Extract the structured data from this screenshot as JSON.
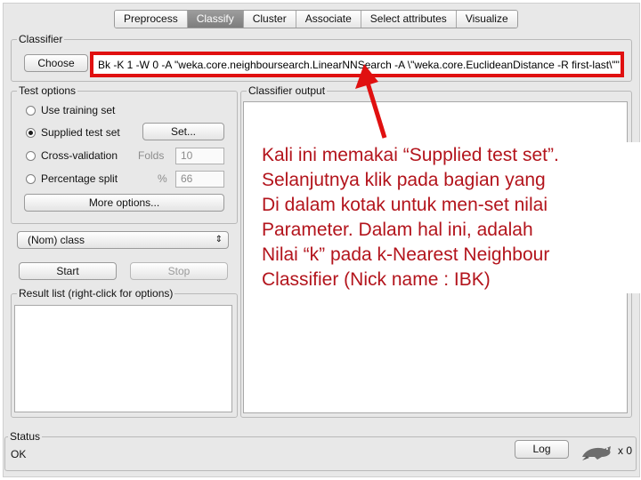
{
  "tabs": [
    "Preprocess",
    "Classify",
    "Cluster",
    "Associate",
    "Select attributes",
    "Visualize"
  ],
  "classifier": {
    "label": "Classifier",
    "choose_label": "Choose",
    "config_text": "Bk -K 1 -W 0 -A \"weka.core.neighboursearch.LinearNNSearch -A \\\"weka.core.EuclideanDistance -R first-last\\\"\""
  },
  "test_options": {
    "label": "Test options",
    "use_training": "Use training set",
    "supplied": "Supplied test set",
    "set_label": "Set...",
    "cross_validation": "Cross-validation",
    "folds_label": "Folds",
    "folds_value": "10",
    "percentage_split": "Percentage split",
    "percent_symbol": "%",
    "percent_value": "66",
    "more_options": "More options...",
    "selected": "supplied"
  },
  "class_select": {
    "value": "(Nom) class",
    "arrow": "⇕"
  },
  "actions": {
    "start": "Start",
    "stop": "Stop"
  },
  "result_list": {
    "label": "Result list (right-click for options)"
  },
  "output": {
    "label": "Classifier output"
  },
  "status": {
    "label": "Status",
    "text": "OK",
    "log_label": "Log",
    "x_count": "x 0"
  },
  "annotation": {
    "lines": [
      "Kali ini memakai “Supplied test set”.",
      "Selanjutnya klik pada bagian yang",
      "Di dalam kotak untuk men-set nilai",
      "Parameter. Dalam hal ini, adalah",
      "Nilai “k” pada k-Nearest Neighbour",
      "Classifier (Nick name : IBK)"
    ],
    "color": "#b3141c",
    "highlight_color": "#e01010"
  }
}
